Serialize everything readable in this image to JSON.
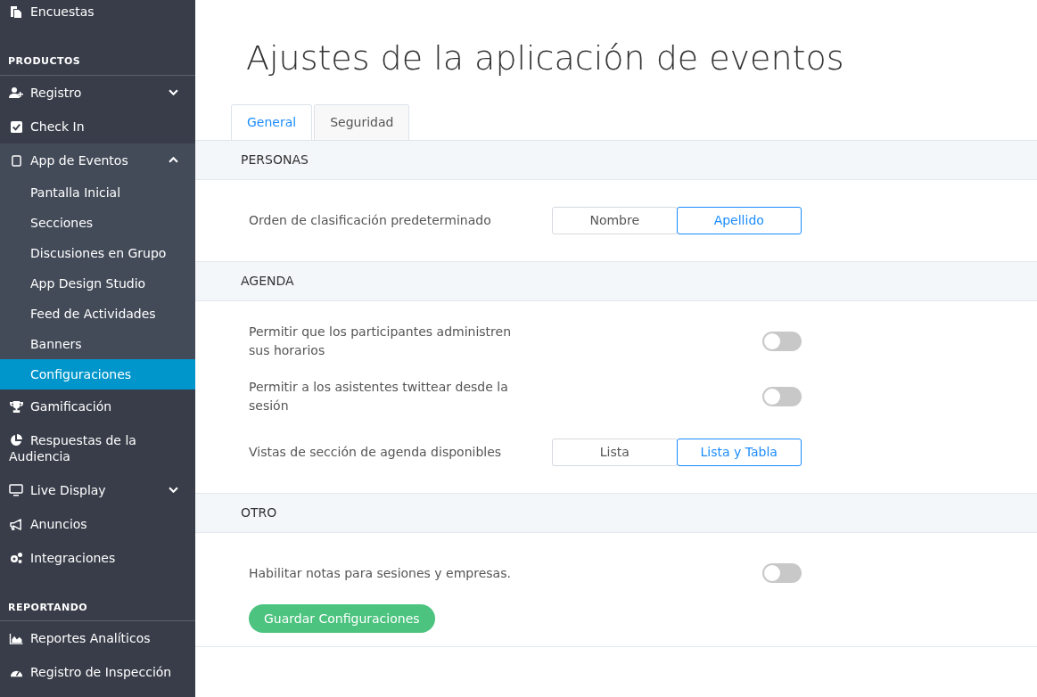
{
  "sidebar": {
    "items": [
      {
        "kind": "item",
        "label": "Encuestas",
        "selected": false
      },
      {
        "kind": "header",
        "label": "PRODUCTOS"
      },
      {
        "kind": "item",
        "label": "Registro",
        "selected": false,
        "expanded": false
      },
      {
        "kind": "item",
        "label": "Check In",
        "selected": false
      },
      {
        "kind": "item",
        "label": "App de Eventos",
        "selected": false,
        "expanded": true,
        "children": [
          {
            "label": "Pantalla Inicial",
            "selected": false
          },
          {
            "label": "Secciones",
            "selected": false
          },
          {
            "label": "Discusiones en Grupo",
            "selected": false
          },
          {
            "label": "App Design Studio",
            "selected": false
          },
          {
            "label": "Feed de Actividades",
            "selected": false
          },
          {
            "label": "Banners",
            "selected": false
          },
          {
            "label": "Configuraciones",
            "selected": true
          }
        ]
      },
      {
        "kind": "item",
        "label": "Gamificación",
        "selected": false
      },
      {
        "kind": "item",
        "label": "Respuestas de la Audiencia",
        "selected": false
      },
      {
        "kind": "item",
        "label": "Live Display",
        "selected": false,
        "expanded": false
      },
      {
        "kind": "item",
        "label": "Anuncios",
        "selected": false
      },
      {
        "kind": "item",
        "label": "Integraciones",
        "selected": false
      },
      {
        "kind": "header",
        "label": "REPORTANDO"
      },
      {
        "kind": "item",
        "label": "Reportes Analíticos",
        "selected": false
      },
      {
        "kind": "item",
        "label": "Registro de Inspección",
        "selected": false
      }
    ]
  },
  "page_title": "Ajustes de la aplicación de eventos",
  "tabs": [
    {
      "label": "General",
      "selected": true
    },
    {
      "label": "Seguridad",
      "selected": false
    }
  ],
  "sections": [
    {
      "title": "PERSONAS",
      "rows": [
        {
          "kind": "segmented",
          "label": "Orden de clasificación predeterminado",
          "options": [
            {
              "label": "Nombre",
              "selected": false
            },
            {
              "label": "Apellido",
              "selected": true
            }
          ]
        }
      ]
    },
    {
      "title": "AGENDA",
      "rows": [
        {
          "kind": "toggle",
          "label": "Permitir que los participantes administren sus horarios",
          "on": false
        },
        {
          "kind": "toggle",
          "label": "Permitir a los asistentes twittear desde la sesión",
          "on": false
        },
        {
          "kind": "segmented",
          "label": "Vistas de sección de agenda disponibles",
          "options": [
            {
              "label": "Lista",
              "selected": false
            },
            {
              "label": "Lista y Tabla",
              "selected": true
            }
          ]
        }
      ]
    },
    {
      "title": "OTRO",
      "rows": [
        {
          "kind": "toggle",
          "label": "Habilitar notas para sesiones y empresas.",
          "on": false
        }
      ]
    }
  ],
  "save_button": "Guardar Configuraciones"
}
